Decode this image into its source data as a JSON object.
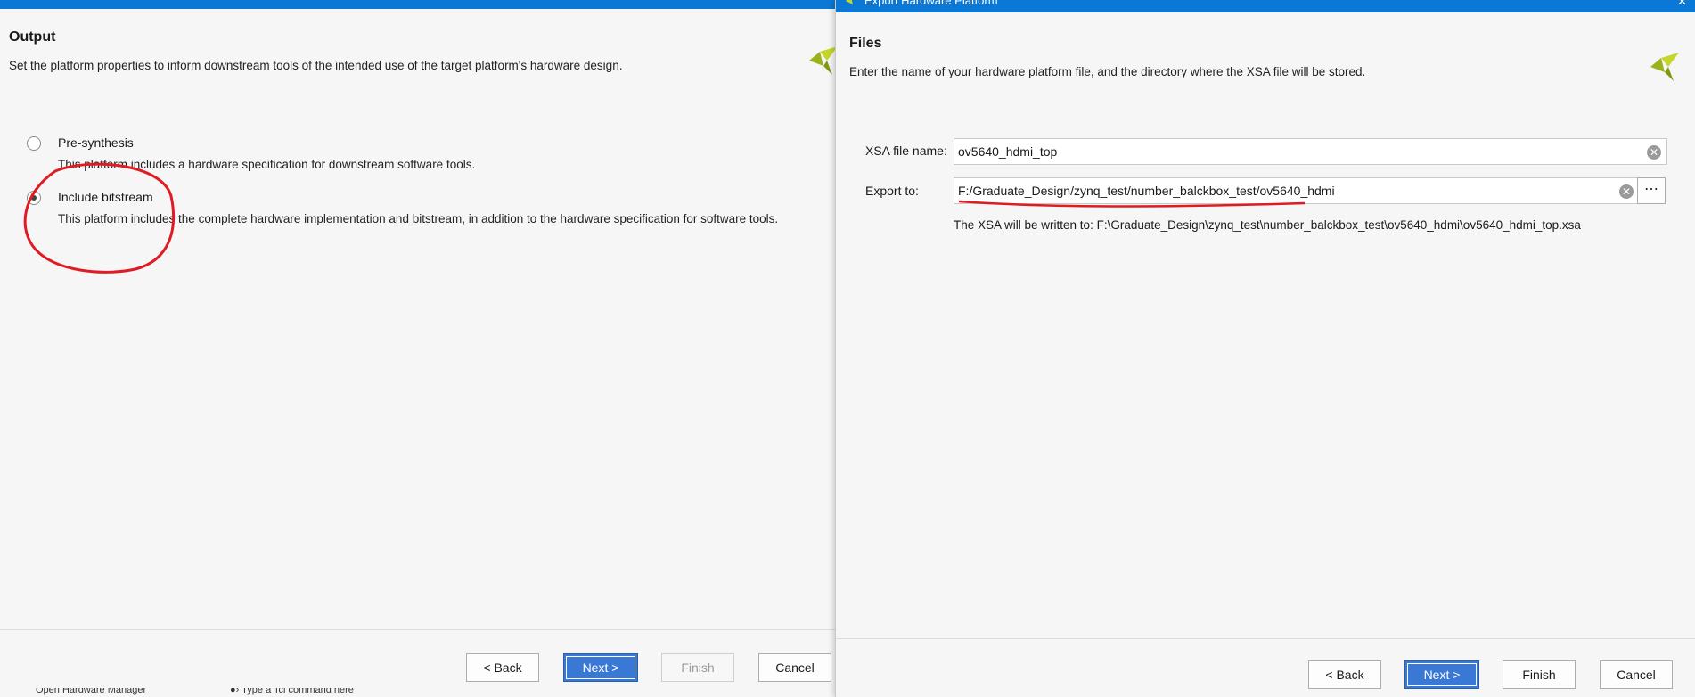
{
  "left": {
    "title": "Output",
    "description": "Set the platform properties to inform downstream tools of the intended use of the target platform's hardware design.",
    "options": [
      {
        "label": "Pre-synthesis",
        "description": "This platform includes a hardware specification for downstream software tools.",
        "checked": false
      },
      {
        "label": "Include bitstream",
        "description": "This platform includes the complete hardware implementation and bitstream, in addition to the hardware specification for software tools.",
        "checked": true
      }
    ],
    "buttons": {
      "back": "< Back",
      "next": "Next >",
      "finish": "Finish",
      "cancel": "Cancel"
    },
    "bottom_strip": {
      "left_text": "Open Hardware Manager",
      "right_text": "●› Type a Tcl command here"
    }
  },
  "right": {
    "window_title": "Export Hardware Platform",
    "title": "Files",
    "description": "Enter the name of your hardware platform file, and the directory where the XSA file will be stored.",
    "fields": {
      "xsa_label": "XSA file name:",
      "xsa_value": "ov5640_hdmi_top",
      "export_label": "Export to:",
      "export_value": "F:/Graduate_Design/zynq_test/number_balckbox_test/ov5640_hdmi"
    },
    "hint": "The XSA will be written to: F:\\Graduate_Design\\zynq_test\\number_balckbox_test\\ov5640_hdmi\\ov5640_hdmi_top.xsa",
    "buttons": {
      "back": "< Back",
      "next": "Next >",
      "finish": "Finish",
      "cancel": "Cancel"
    }
  },
  "colors": {
    "accent": "#0a78d4",
    "primary_button": "#3a78d6",
    "annotation": "#e01b24",
    "logo": "#9ab31c"
  }
}
